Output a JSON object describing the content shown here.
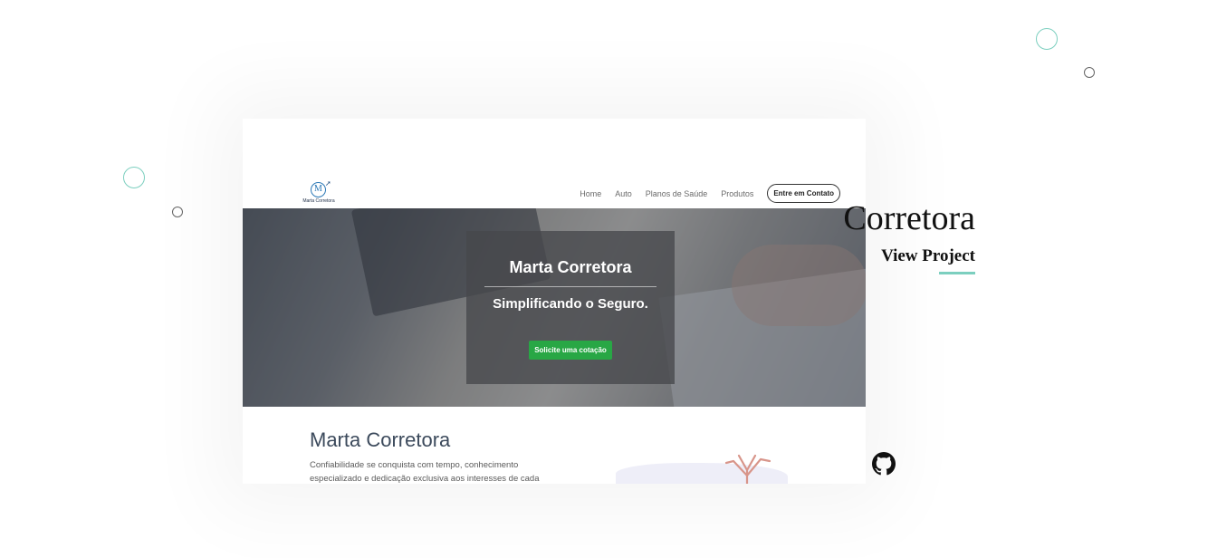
{
  "decorations": {
    "accent_color": "#7ccfbf",
    "outline_color": "#666666"
  },
  "project": {
    "title": "Corretora",
    "link_label": "View Project",
    "github_icon": "github-icon"
  },
  "screenshot": {
    "logo_initial": "M",
    "logo_text": "Marta Corretora",
    "nav": {
      "links": [
        "Home",
        "Auto",
        "Planos de Saúde",
        "Produtos"
      ],
      "contact_label": "Entre em Contato"
    },
    "hero": {
      "title": "Marta Corretora",
      "subtitle": "Simplificando o Seguro.",
      "button_label": "Solicite uma cotação",
      "button_color": "#28a745"
    },
    "about": {
      "title": "Marta Corretora",
      "text": "Confiabilidade se conquista com tempo, conhecimento especializado e dedicação exclusiva aos interesses de cada"
    }
  }
}
